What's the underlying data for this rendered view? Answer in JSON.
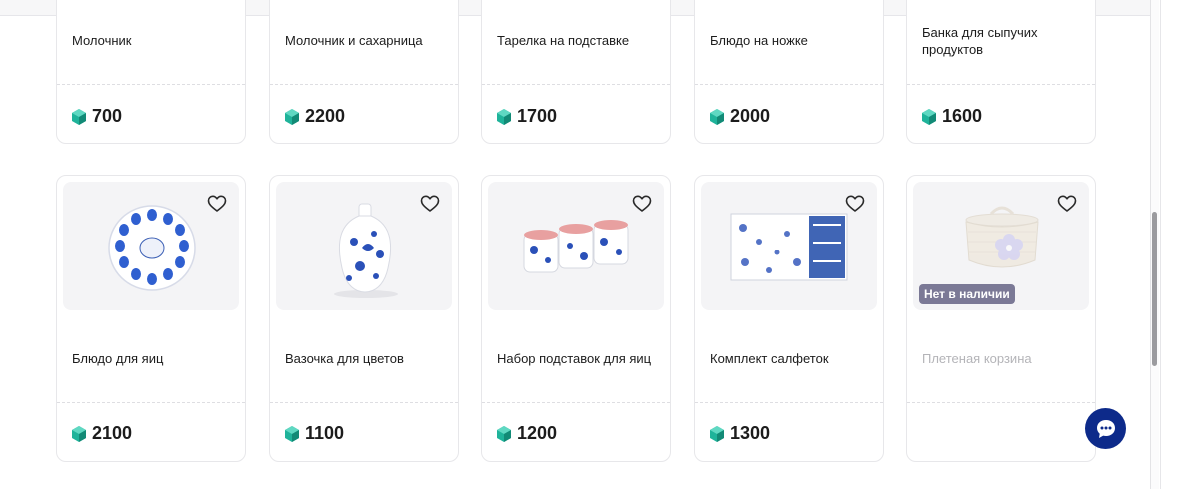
{
  "currency_icon": "gem-coin-icon",
  "colors": {
    "accent": "#2c4aa8",
    "coin": "#1fb39a",
    "badge": "#7b7996",
    "chat": "#0d2a8a"
  },
  "top_row": [
    {
      "name": "Молочник",
      "price": "700"
    },
    {
      "name": "Молочник и сахарница",
      "price": "2200"
    },
    {
      "name": "Тарелка на подставке",
      "price": "1700"
    },
    {
      "name": "Блюдо на ножке",
      "price": "2000"
    },
    {
      "name": "Банка для сыпучих продуктов",
      "price": "1600"
    }
  ],
  "bottom_row": [
    {
      "name": "Блюдо для яиц",
      "price": "2100"
    },
    {
      "name": "Вазочка для цветов",
      "price": "1100"
    },
    {
      "name": "Набор подставок для яиц",
      "price": "1200"
    },
    {
      "name": "Комплект салфеток",
      "price": "1300"
    },
    {
      "name": "Плетеная корзина",
      "status": "Нет в наличии"
    }
  ]
}
